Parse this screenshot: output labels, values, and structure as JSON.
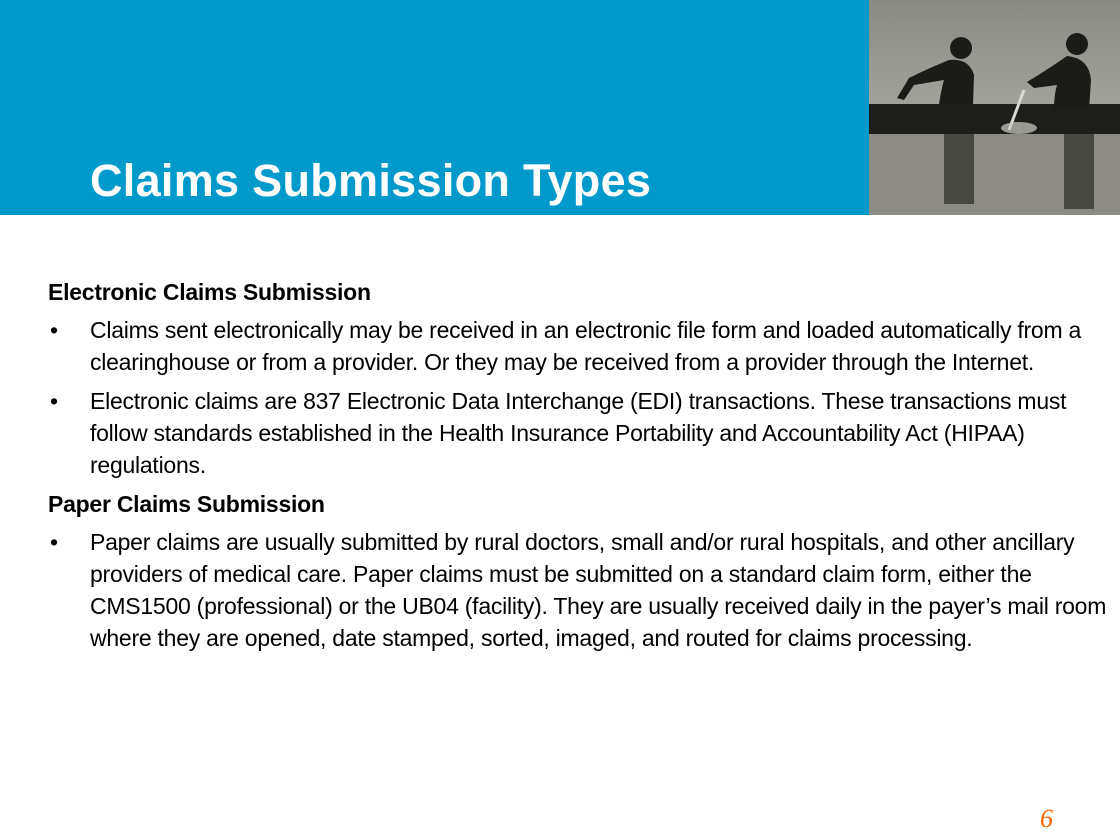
{
  "slide": {
    "title": "Claims Submission Types",
    "banner_color": "#0099CC",
    "image": "rowers-silhouette-photo",
    "sections": [
      {
        "heading": "Electronic Claims Submission",
        "bullets": [
          "Claims sent electronically may be received in an electronic file form and loaded automatically from a clearinghouse or from a provider. Or they may be received from a provider through the Internet.",
          "Electronic claims are 837 Electronic Data Interchange (EDI) transactions. These transactions must follow standards established in the Health Insurance Portability and Accountability Act (HIPAA) regulations."
        ]
      },
      {
        "heading": "Paper Claims Submission",
        "bullets": [
          "Paper claims are usually submitted by rural doctors, small and/or rural hospitals, and other ancillary providers of medical care. Paper claims must be submitted on a standard claim form, either the CMS1500 (professional) or the UB04 (facility). They are usually received daily in the payer’s mail room where they are opened, date stamped, sorted, imaged, and routed for claims processing."
        ]
      }
    ],
    "bullet_char": "•",
    "page_number": "6",
    "page_number_color": "#FF6600"
  }
}
